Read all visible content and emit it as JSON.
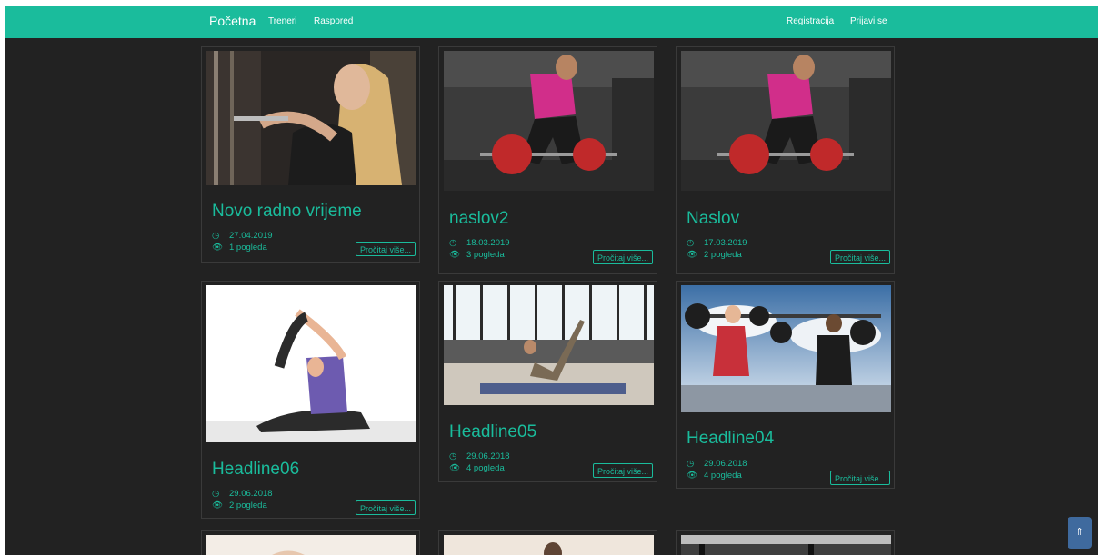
{
  "navbar": {
    "brand": "Početna",
    "left_links": [
      "Treneri",
      "Raspored"
    ],
    "right_links": [
      "Registracija",
      "Prijavi se"
    ],
    "color": "#1abc9c"
  },
  "cards": [
    {
      "title": "Novo radno vrijeme",
      "date": "27.04.2019",
      "views": "1 pogleda",
      "button": "Pročitaj više..."
    },
    {
      "title": "naslov2",
      "date": "18.03.2019",
      "views": "3 pogleda",
      "button": "Pročitaj više..."
    },
    {
      "title": "Naslov",
      "date": "17.03.2019",
      "views": "2 pogleda",
      "button": "Pročitaj više..."
    },
    {
      "title": "Headline06",
      "date": "29.06.2018",
      "views": "2 pogleda",
      "button": "Pročitaj više..."
    },
    {
      "title": "Headline05",
      "date": "29.06.2018",
      "views": "4 pogleda",
      "button": "Pročitaj više..."
    },
    {
      "title": "Headline04",
      "date": "29.06.2018",
      "views": "4 pogleda",
      "button": "Pročitaj više..."
    }
  ],
  "icons": {
    "date": "clock-icon",
    "views": "eye-icon",
    "scroll": "arrow-up-icon"
  },
  "scroll_top_label": "⇑"
}
